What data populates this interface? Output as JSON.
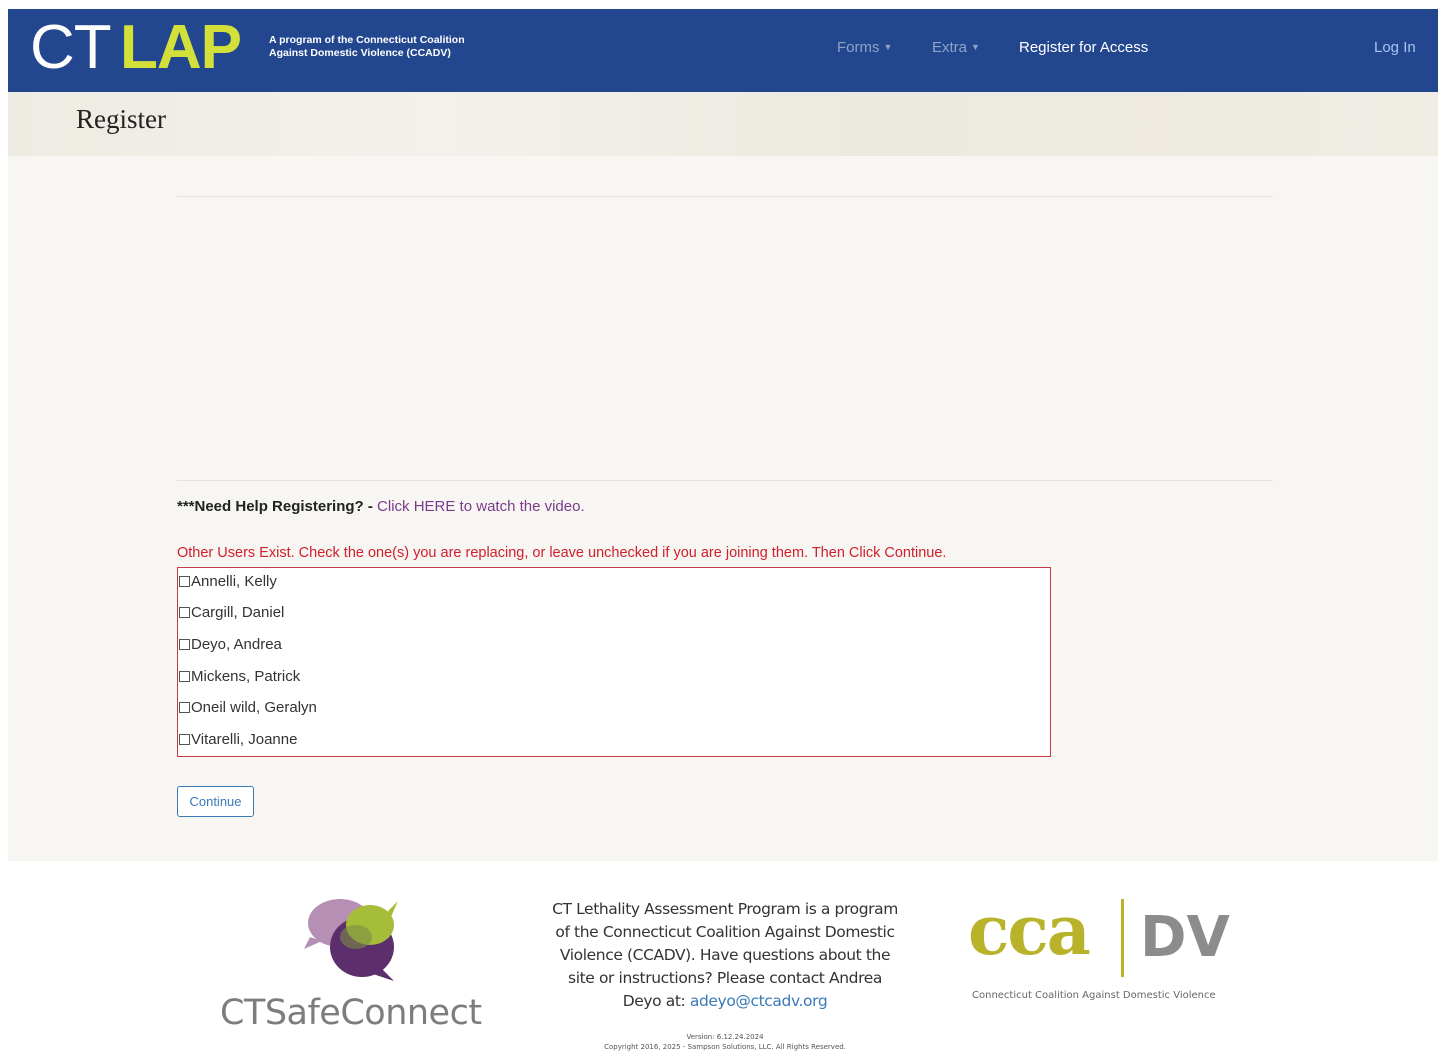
{
  "navbar": {
    "brand_ct": "CT",
    "brand_lap": "LAP",
    "brand_tagline": "A program of the Connecticut Coalition\nAgainst Domestic Violence (CCADV)",
    "forms_label": "Forms",
    "extra_label": "Extra",
    "register_label": "Register for Access",
    "login_label": "Log In"
  },
  "page": {
    "title": "Register"
  },
  "help": {
    "bold": "***Need Help Registering? -",
    "link": "Click HERE to watch the video."
  },
  "users": {
    "warning": "Other Users Exist. Check the one(s) you are replacing, or leave unchecked if you are joining them. Then Click Continue.",
    "list": [
      {
        "name": "Annelli, Kelly",
        "checked": false
      },
      {
        "name": "Cargill, Daniel",
        "checked": false
      },
      {
        "name": "Deyo, Andrea",
        "checked": false
      },
      {
        "name": "Mickens, Patrick",
        "checked": false
      },
      {
        "name": "Oneil wild, Geralyn",
        "checked": false
      },
      {
        "name": "Vitarelli, Joanne",
        "checked": false
      }
    ],
    "continue_label": "Continue"
  },
  "footer": {
    "ctsafeconnect": "CTSafeConnect",
    "text": "CT Lethality Assessment Program is a program of the Connecticut Coalition Against Domestic Violence (CCADV). Have questions about the site or instructions? Please contact Andrea Deyo at:",
    "email": "adeyo@ctcadv.org",
    "version": "Version: 6.12.24.2024",
    "copyright": "Copyright 2016, 2025 - Sampson Solutions, LLC. All Rights Reserved.",
    "ccadv_cca": "cca",
    "ccadv_dv": "DV",
    "ccadv_sub": "Connecticut Coalition Against Domestic Violence"
  },
  "colors": {
    "navbar": "#23478f",
    "brand_accent": "#d4e03a",
    "warning": "#d0202e",
    "link": "#7a3b8c",
    "button": "#3a7ab8",
    "ccadv_olive": "#b8b32a"
  }
}
